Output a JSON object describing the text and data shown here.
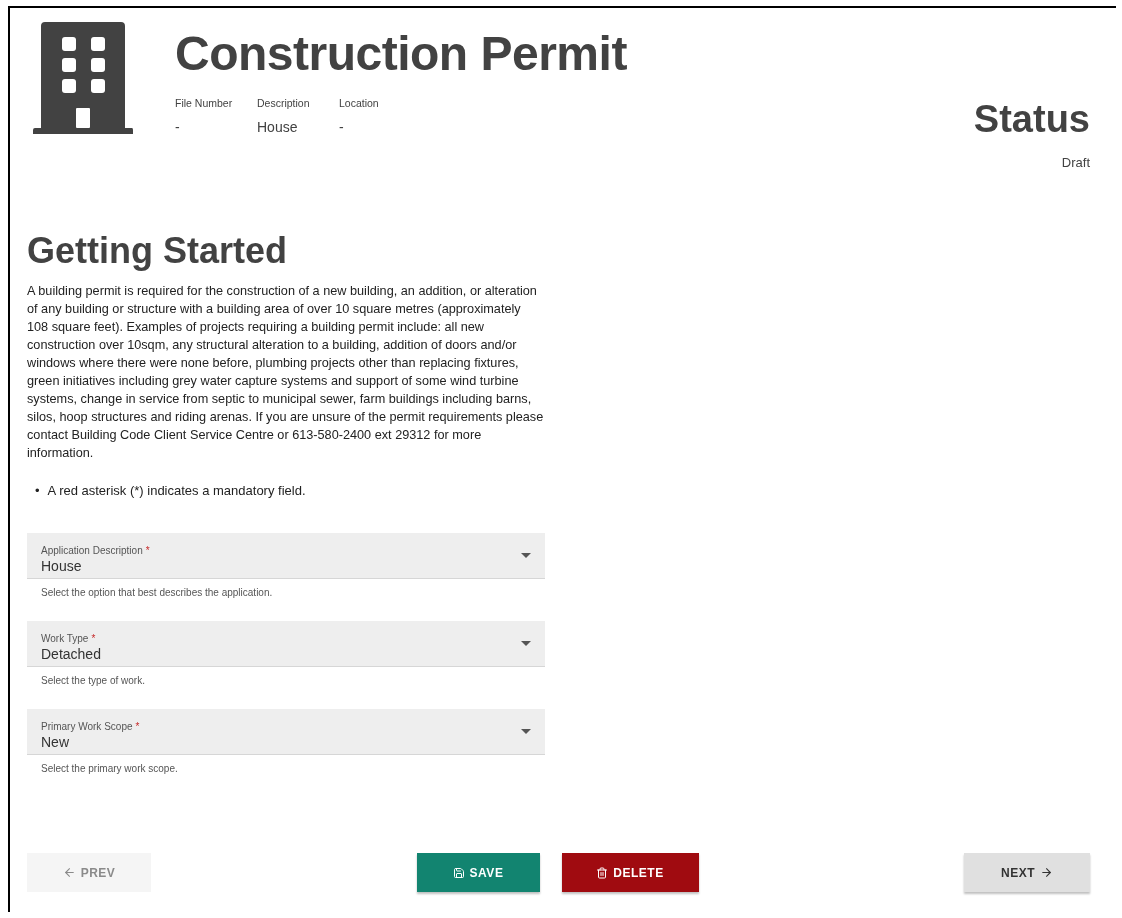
{
  "header": {
    "title": "Construction Permit",
    "meta": [
      {
        "label": "File Number",
        "value": "-"
      },
      {
        "label": "Description",
        "value": "House"
      },
      {
        "label": "Location",
        "value": "-"
      }
    ],
    "status": {
      "label": "Status",
      "value": "Draft"
    }
  },
  "section": {
    "title": "Getting Started",
    "intro": "A building permit is required for the construction of a new building, an addition, or alteration of any building or structure with a building area of over 10 square metres (approximately 108 square feet). Examples of projects requiring a building permit include: all new construction over 10sqm, any structural alteration to a building, addition of doors and/or windows where there were none before, plumbing projects other than replacing fixtures, green initiatives including grey water capture systems and support of some wind turbine systems, change in service from septic to municipal sewer, farm buildings including barns, silos, hoop structures and riding arenas. If you are unsure of the permit requirements please contact Building Code Client Service Centre or 613-580-2400 ext 29312 for more information.",
    "bullets": [
      {
        "marker": "•",
        "text": "A red asterisk (*) indicates a mandatory field."
      }
    ]
  },
  "fields": [
    {
      "label": "Application Description",
      "required_mark": "*",
      "value": "House",
      "helper": "Select the option that best describes the application."
    },
    {
      "label": "Work Type",
      "required_mark": "*",
      "value": "Detached",
      "helper": "Select the type of work."
    },
    {
      "label": "Primary Work Scope",
      "required_mark": "*",
      "value": "New",
      "helper": "Select the primary work scope."
    }
  ],
  "buttons": [
    {
      "kind": "prev",
      "label": "PREV",
      "disabled": true
    },
    {
      "kind": "save",
      "label": "SAVE",
      "disabled": false
    },
    {
      "kind": "delete",
      "label": "DELETE",
      "disabled": false
    },
    {
      "kind": "next",
      "label": "NEXT",
      "disabled": false
    }
  ]
}
